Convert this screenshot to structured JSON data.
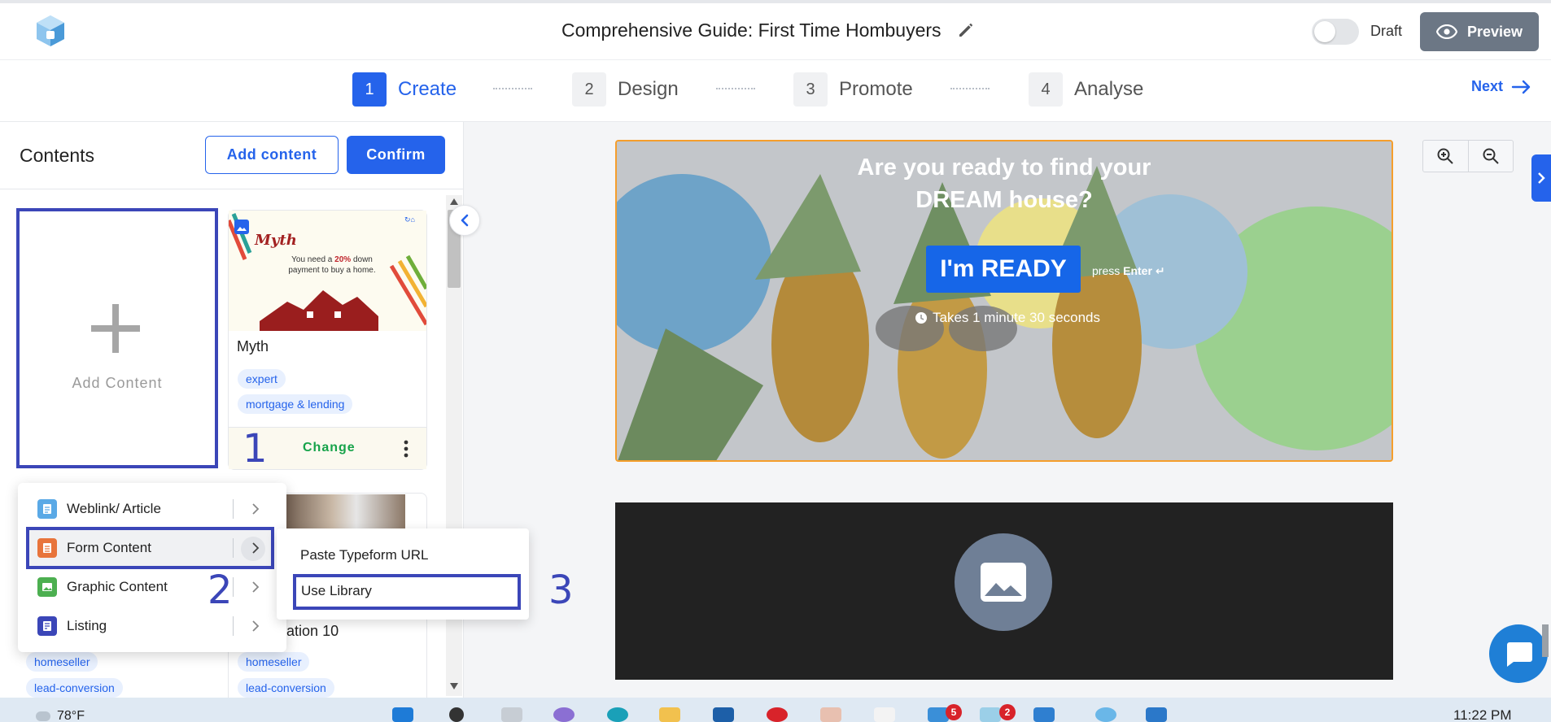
{
  "header": {
    "title": "Comprehensive Guide: First Time Hombuyers",
    "draft_label": "Draft",
    "preview_label": "Preview"
  },
  "steps": [
    {
      "num": "1",
      "label": "Create",
      "active": true
    },
    {
      "num": "2",
      "label": "Design",
      "active": false
    },
    {
      "num": "3",
      "label": "Promote",
      "active": false
    },
    {
      "num": "4",
      "label": "Analyse",
      "active": false
    }
  ],
  "next_label": "Next",
  "left_panel": {
    "title": "Contents",
    "add_content_button": "Add content",
    "confirm_button": "Confirm",
    "add_card_label": "Add Content",
    "cards": [
      {
        "name": "Myth",
        "thumb_title": "Myth",
        "thumb_text_1": "You need a",
        "thumb_highlight": "20%",
        "thumb_text_2": "down payment to buy a home.",
        "tags": [
          "expert",
          "mortgage & lending"
        ],
        "action": "Change"
      },
      {
        "name": "presentation 10",
        "tags": [
          "homeseller",
          "lead-conversion"
        ]
      }
    ],
    "left_column_tags": [
      "homeseller",
      "lead-conversion"
    ]
  },
  "menu": {
    "items": [
      {
        "label": "Weblink/ Article",
        "icon": "article-icon",
        "color": "#5aa9e6"
      },
      {
        "label": "Form Content",
        "icon": "form-icon",
        "color": "#e8743b"
      },
      {
        "label": "Graphic Content",
        "icon": "image-icon",
        "color": "#4caf50"
      },
      {
        "label": "Listing",
        "icon": "listing-icon",
        "color": "#3b46b8"
      }
    ],
    "submenu": [
      "Paste Typeform URL",
      "Use Library"
    ]
  },
  "annotations": [
    "1",
    "2",
    "3"
  ],
  "preview": {
    "headline": "Are you ready to find your DREAM house?",
    "cta": "I'm READY",
    "press_prefix": "press",
    "press_key": "Enter",
    "duration": "Takes 1 minute 30 seconds"
  },
  "taskbar": {
    "weather": "78°F",
    "time": "11:22 PM",
    "badges": [
      "5",
      "2"
    ]
  },
  "colors": {
    "accent": "#2563eb",
    "annotation": "#3b46b8",
    "hero_border": "#f59e2c"
  }
}
